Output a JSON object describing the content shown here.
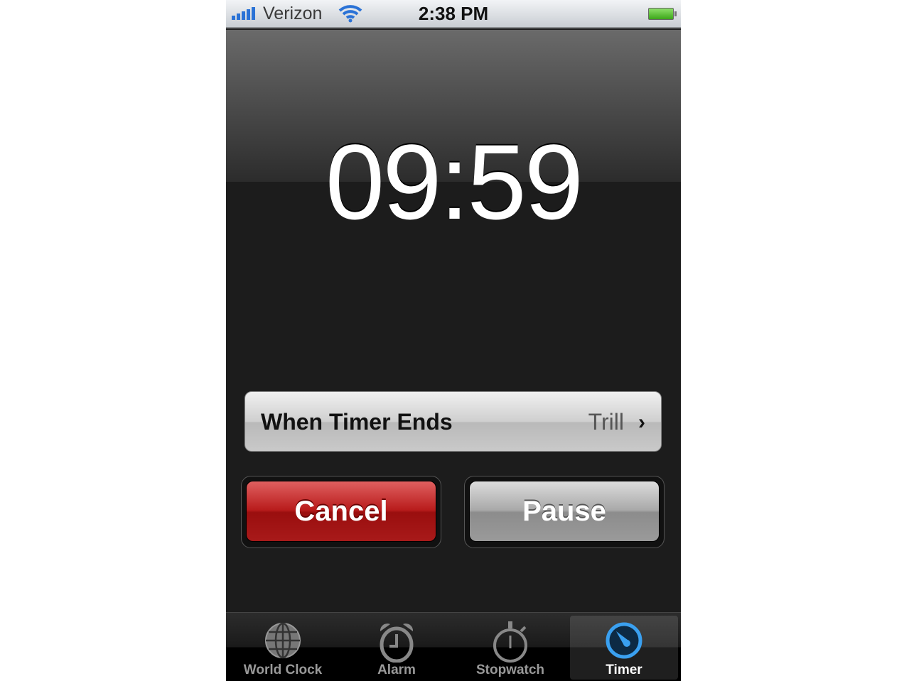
{
  "status_bar": {
    "carrier": "Verizon",
    "time": "2:38 PM",
    "signal_bars": 5,
    "wifi": "wifi-icon",
    "battery_level": "full"
  },
  "timer": {
    "remaining": "09:59"
  },
  "when_timer_ends": {
    "label": "When Timer Ends",
    "value": "Trill"
  },
  "buttons": {
    "cancel": "Cancel",
    "pause": "Pause"
  },
  "colors": {
    "cancel": "#b81c1c",
    "active_tab": "#3aa0f0"
  },
  "tabs": [
    {
      "label": "World Clock",
      "icon": "globe-icon"
    },
    {
      "label": "Alarm",
      "icon": "alarm-clock-icon"
    },
    {
      "label": "Stopwatch",
      "icon": "stopwatch-icon"
    },
    {
      "label": "Timer",
      "icon": "timer-icon",
      "active": true
    }
  ]
}
